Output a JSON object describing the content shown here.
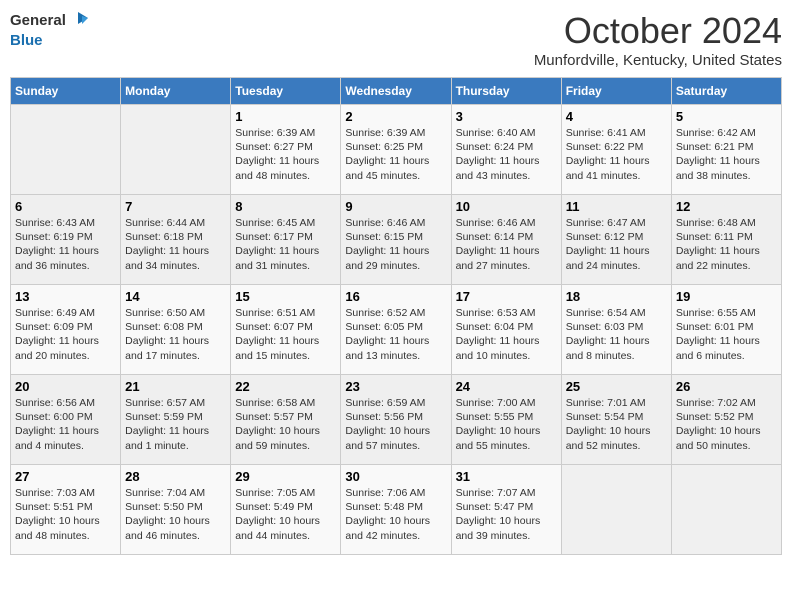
{
  "header": {
    "logo_line1": "General",
    "logo_line2": "Blue",
    "month": "October 2024",
    "location": "Munfordville, Kentucky, United States"
  },
  "weekdays": [
    "Sunday",
    "Monday",
    "Tuesday",
    "Wednesday",
    "Thursday",
    "Friday",
    "Saturday"
  ],
  "weeks": [
    [
      {
        "day": "",
        "info": ""
      },
      {
        "day": "",
        "info": ""
      },
      {
        "day": "1",
        "info": "Sunrise: 6:39 AM\nSunset: 6:27 PM\nDaylight: 11 hours and 48 minutes."
      },
      {
        "day": "2",
        "info": "Sunrise: 6:39 AM\nSunset: 6:25 PM\nDaylight: 11 hours and 45 minutes."
      },
      {
        "day": "3",
        "info": "Sunrise: 6:40 AM\nSunset: 6:24 PM\nDaylight: 11 hours and 43 minutes."
      },
      {
        "day": "4",
        "info": "Sunrise: 6:41 AM\nSunset: 6:22 PM\nDaylight: 11 hours and 41 minutes."
      },
      {
        "day": "5",
        "info": "Sunrise: 6:42 AM\nSunset: 6:21 PM\nDaylight: 11 hours and 38 minutes."
      }
    ],
    [
      {
        "day": "6",
        "info": "Sunrise: 6:43 AM\nSunset: 6:19 PM\nDaylight: 11 hours and 36 minutes."
      },
      {
        "day": "7",
        "info": "Sunrise: 6:44 AM\nSunset: 6:18 PM\nDaylight: 11 hours and 34 minutes."
      },
      {
        "day": "8",
        "info": "Sunrise: 6:45 AM\nSunset: 6:17 PM\nDaylight: 11 hours and 31 minutes."
      },
      {
        "day": "9",
        "info": "Sunrise: 6:46 AM\nSunset: 6:15 PM\nDaylight: 11 hours and 29 minutes."
      },
      {
        "day": "10",
        "info": "Sunrise: 6:46 AM\nSunset: 6:14 PM\nDaylight: 11 hours and 27 minutes."
      },
      {
        "day": "11",
        "info": "Sunrise: 6:47 AM\nSunset: 6:12 PM\nDaylight: 11 hours and 24 minutes."
      },
      {
        "day": "12",
        "info": "Sunrise: 6:48 AM\nSunset: 6:11 PM\nDaylight: 11 hours and 22 minutes."
      }
    ],
    [
      {
        "day": "13",
        "info": "Sunrise: 6:49 AM\nSunset: 6:09 PM\nDaylight: 11 hours and 20 minutes."
      },
      {
        "day": "14",
        "info": "Sunrise: 6:50 AM\nSunset: 6:08 PM\nDaylight: 11 hours and 17 minutes."
      },
      {
        "day": "15",
        "info": "Sunrise: 6:51 AM\nSunset: 6:07 PM\nDaylight: 11 hours and 15 minutes."
      },
      {
        "day": "16",
        "info": "Sunrise: 6:52 AM\nSunset: 6:05 PM\nDaylight: 11 hours and 13 minutes."
      },
      {
        "day": "17",
        "info": "Sunrise: 6:53 AM\nSunset: 6:04 PM\nDaylight: 11 hours and 10 minutes."
      },
      {
        "day": "18",
        "info": "Sunrise: 6:54 AM\nSunset: 6:03 PM\nDaylight: 11 hours and 8 minutes."
      },
      {
        "day": "19",
        "info": "Sunrise: 6:55 AM\nSunset: 6:01 PM\nDaylight: 11 hours and 6 minutes."
      }
    ],
    [
      {
        "day": "20",
        "info": "Sunrise: 6:56 AM\nSunset: 6:00 PM\nDaylight: 11 hours and 4 minutes."
      },
      {
        "day": "21",
        "info": "Sunrise: 6:57 AM\nSunset: 5:59 PM\nDaylight: 11 hours and 1 minute."
      },
      {
        "day": "22",
        "info": "Sunrise: 6:58 AM\nSunset: 5:57 PM\nDaylight: 10 hours and 59 minutes."
      },
      {
        "day": "23",
        "info": "Sunrise: 6:59 AM\nSunset: 5:56 PM\nDaylight: 10 hours and 57 minutes."
      },
      {
        "day": "24",
        "info": "Sunrise: 7:00 AM\nSunset: 5:55 PM\nDaylight: 10 hours and 55 minutes."
      },
      {
        "day": "25",
        "info": "Sunrise: 7:01 AM\nSunset: 5:54 PM\nDaylight: 10 hours and 52 minutes."
      },
      {
        "day": "26",
        "info": "Sunrise: 7:02 AM\nSunset: 5:52 PM\nDaylight: 10 hours and 50 minutes."
      }
    ],
    [
      {
        "day": "27",
        "info": "Sunrise: 7:03 AM\nSunset: 5:51 PM\nDaylight: 10 hours and 48 minutes."
      },
      {
        "day": "28",
        "info": "Sunrise: 7:04 AM\nSunset: 5:50 PM\nDaylight: 10 hours and 46 minutes."
      },
      {
        "day": "29",
        "info": "Sunrise: 7:05 AM\nSunset: 5:49 PM\nDaylight: 10 hours and 44 minutes."
      },
      {
        "day": "30",
        "info": "Sunrise: 7:06 AM\nSunset: 5:48 PM\nDaylight: 10 hours and 42 minutes."
      },
      {
        "day": "31",
        "info": "Sunrise: 7:07 AM\nSunset: 5:47 PM\nDaylight: 10 hours and 39 minutes."
      },
      {
        "day": "",
        "info": ""
      },
      {
        "day": "",
        "info": ""
      }
    ]
  ]
}
